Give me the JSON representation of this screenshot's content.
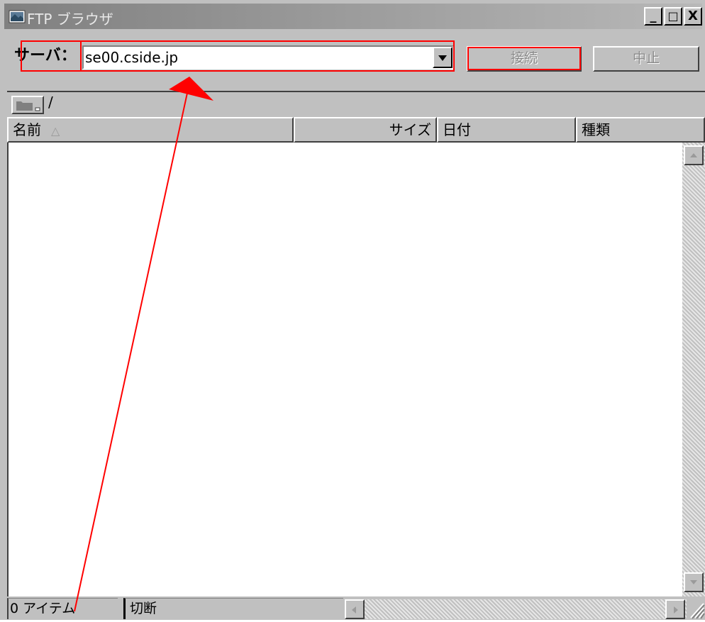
{
  "window": {
    "title": "FTP ブラウザ",
    "controls": {
      "minimize": "_",
      "maximize": "□",
      "close": "X"
    }
  },
  "server": {
    "label": "サーバ：",
    "value": "se00.cside.jp"
  },
  "buttons": {
    "connect": "接続",
    "stop": "中止"
  },
  "path": {
    "current": "/"
  },
  "columns": [
    {
      "label": "名前",
      "sorted": "ascending"
    },
    {
      "label": "サイズ"
    },
    {
      "label": "日付"
    },
    {
      "label": "種類"
    }
  ],
  "sort_indicator": "△",
  "status": {
    "items": "0 アイテム",
    "connection": "切断"
  },
  "annotation_color": "#ff0000"
}
